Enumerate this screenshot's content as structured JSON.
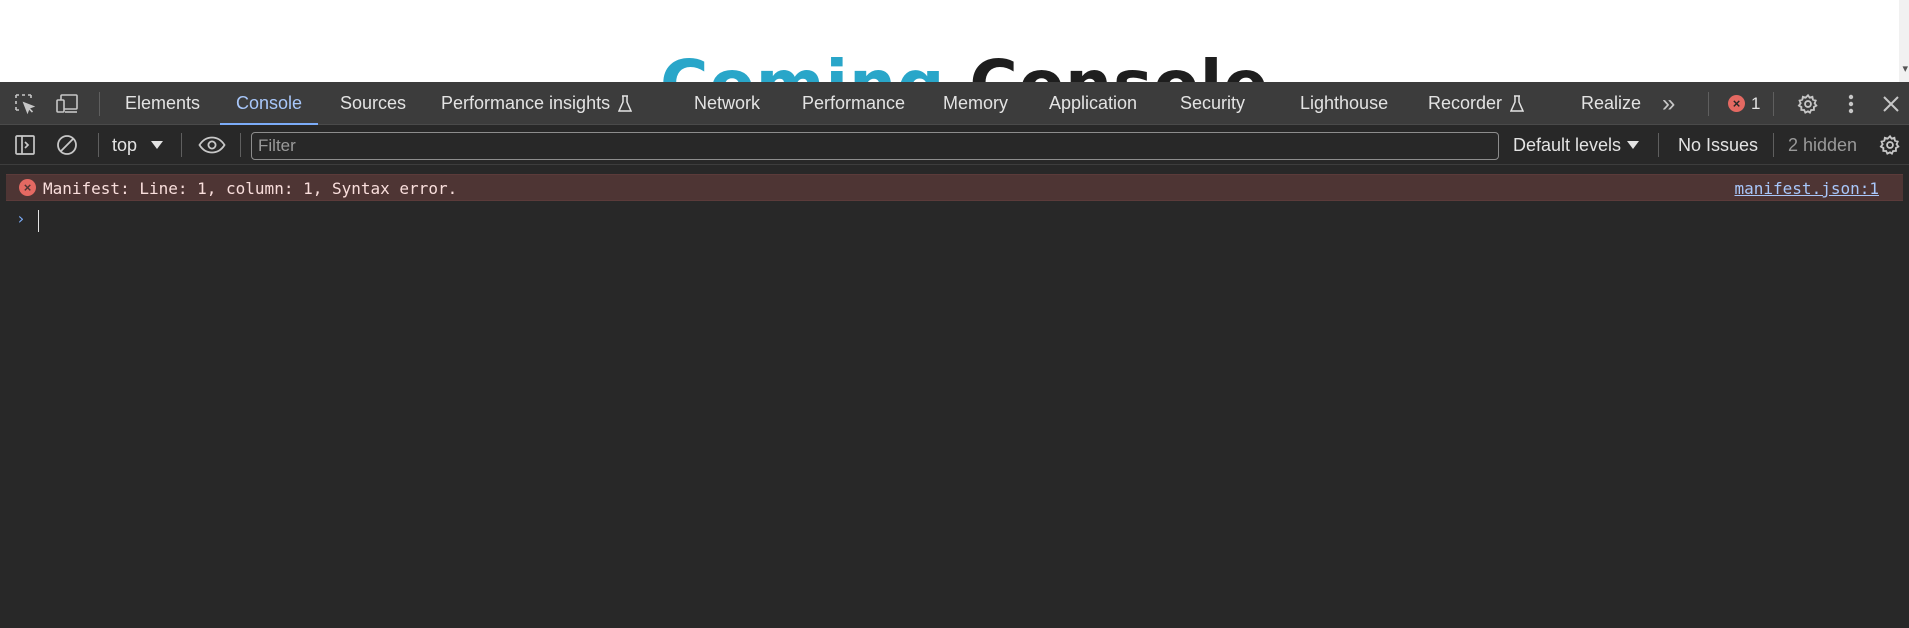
{
  "page": {
    "heading_word1": "Coming",
    "heading_word2": "Console"
  },
  "tabbar": {
    "tabs": [
      {
        "label": "Elements",
        "active": false,
        "experimental": false
      },
      {
        "label": "Console",
        "active": true,
        "experimental": false
      },
      {
        "label": "Sources",
        "active": false,
        "experimental": false
      },
      {
        "label": "Performance insights",
        "active": false,
        "experimental": true
      },
      {
        "label": "Network",
        "active": false,
        "experimental": false
      },
      {
        "label": "Performance",
        "active": false,
        "experimental": false
      },
      {
        "label": "Memory",
        "active": false,
        "experimental": false
      },
      {
        "label": "Application",
        "active": false,
        "experimental": false
      },
      {
        "label": "Security",
        "active": false,
        "experimental": false
      },
      {
        "label": "Lighthouse",
        "active": false,
        "experimental": false
      },
      {
        "label": "Recorder",
        "active": false,
        "experimental": true
      },
      {
        "label": "Realize",
        "active": false,
        "experimental": false
      }
    ],
    "more_tabs_glyph": "»",
    "error_count": "1"
  },
  "toolbar": {
    "context": "top",
    "filter_placeholder": "Filter",
    "filter_value": "",
    "levels_label": "Default levels",
    "issues_label": "No Issues",
    "hidden_label": "2 hidden"
  },
  "messages": [
    {
      "level": "error",
      "text": "Manifest: Line: 1, column: 1, Syntax error.",
      "source": "manifest.json:1"
    }
  ],
  "prompt": {
    "chevron": "›",
    "value": ""
  },
  "colors": {
    "panel_bg": "#282828",
    "tabbar_bg": "#3c3c3c",
    "accent": "#a8c7fa",
    "error_row_bg": "#4e3534",
    "error_icon": "#e46962"
  }
}
